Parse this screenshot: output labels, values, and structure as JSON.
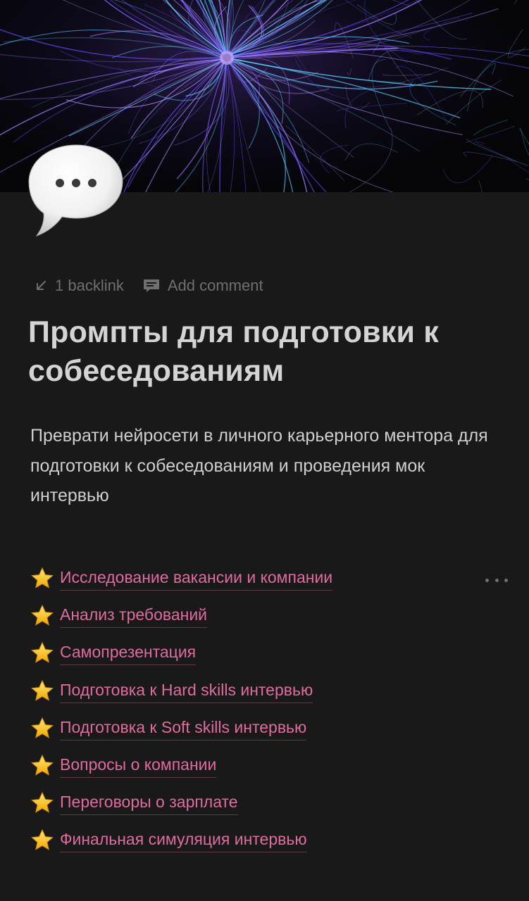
{
  "meta": {
    "backlink_label": "1 backlink",
    "comment_label": "Add comment"
  },
  "page": {
    "title": "Промпты для подготовки к собеседованиям",
    "description": "Преврати нейросети в личного карьерного ментора для подготовки к собеседованиям и проведения мок интервью",
    "icon": "speech-bubble-icon"
  },
  "links": [
    {
      "label": "Исследование вакансии и компании",
      "icon": "star-icon"
    },
    {
      "label": "Анализ требований",
      "icon": "star-icon"
    },
    {
      "label": "Самопрезентация",
      "icon": "star-icon"
    },
    {
      "label": "Подготовка к Hard skills интервью",
      "icon": "star-icon"
    },
    {
      "label": "Подготовка к Soft skills интервью",
      "icon": "star-icon"
    },
    {
      "label": "Вопросы о компании",
      "icon": "star-icon"
    },
    {
      "label": "Переговоры о зарплате",
      "icon": "star-icon"
    },
    {
      "label": "Финальная симуляция интервью",
      "icon": "star-icon"
    }
  ],
  "colors": {
    "background": "#191919",
    "link": "#e06ba0",
    "title": "#d4d4d4",
    "muted": "#6f6f6f"
  }
}
